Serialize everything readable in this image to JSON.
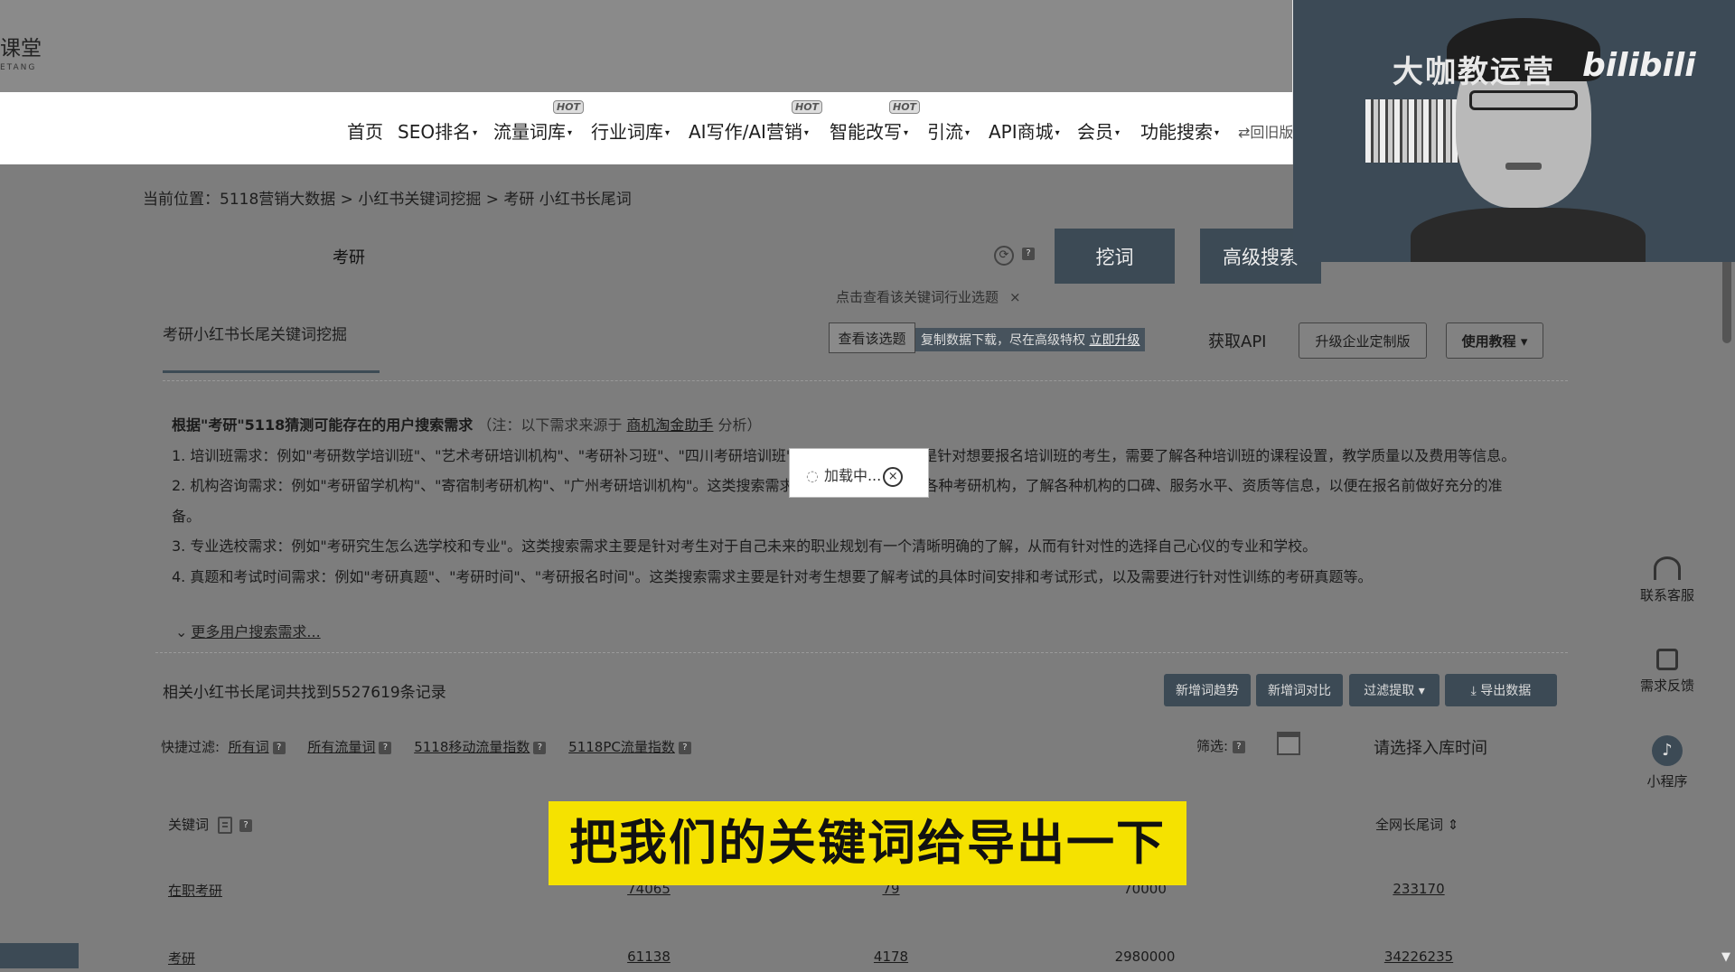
{
  "logo": {
    "main": "课堂",
    "sub": "ETANG"
  },
  "nav": {
    "items": [
      {
        "label": "首页",
        "caret": ""
      },
      {
        "label": "SEO排名",
        "caret": "▾"
      },
      {
        "label": "流量词库",
        "caret": "▾",
        "hot": "HOT"
      },
      {
        "label": "行业词库",
        "caret": "▾"
      },
      {
        "label": "AI写作/AI营销",
        "caret": "▾",
        "hot": "HOT"
      },
      {
        "label": "智能改写",
        "caret": "▾",
        "hot": "HOT"
      },
      {
        "label": "引流",
        "caret": "▾"
      },
      {
        "label": "API商城",
        "caret": "▾"
      },
      {
        "label": "会员",
        "caret": "▾"
      },
      {
        "label": "功能搜索",
        "caret": "▾"
      }
    ],
    "old_version": "⇄回旧版"
  },
  "breadcrumb": "当前位置：5118营销大数据 > 小红书关键词挖掘 > 考研 小红书长尾词",
  "search": {
    "value": "考研",
    "dig_button": "挖词",
    "advanced_button": "高级搜索",
    "hint": "点击查看该关键词行业选题",
    "hint_close": "×",
    "help": "?"
  },
  "tab": {
    "title": "考研小红书长尾关键词挖掘"
  },
  "actions": {
    "view_topic": "查看该选题",
    "promo_text": "复制数据下载，尽在高级特权",
    "promo_link": "立即升级",
    "api": "获取API",
    "enterprise": "升级企业定制版",
    "tutorial": "使用教程 ▾"
  },
  "needs": {
    "lead": "根据\"考研\"5118猜测可能存在的用户搜索需求",
    "note_prefix": "（注：以下需求来源于",
    "note_link": "商机淘金助手",
    "note_suffix": "分析）",
    "items": [
      "1. 培训班需求：例如\"考研数学培训班\"、\"艺术考研培训机构\"、\"考研补习班\"、\"四川考研培训班\"。这类搜索需求主要是针对想要报名培训班的考生，需要了解各种培训班的课程设置，教学质量以及费用等信息。",
      "2. 机构咨询需求：例如\"考研留学机构\"、\"寄宿制考研机构\"、\"广州考研培训机构\"。这类搜索需求主要是针对想要了解各种考研机构，了解各种机构的口碑、服务水平、资质等信息，以便在报名前做好充分的准备。",
      "3. 专业选校需求：例如\"考研究生怎么选学校和专业\"。这类搜索需求主要是针对考生对于自己未来的职业规划有一个清晰明确的了解，从而有针对性的选择自己心仪的专业和学校。",
      "4. 真题和考试时间需求：例如\"考研真题\"、\"考研时间\"、\"考研报名时间\"。这类搜索需求主要是针对考生想要了解考试的具体时间安排和考试形式，以及需要进行针对性训练的考研真题等。"
    ],
    "more": "更多用户搜索需求..."
  },
  "loading": {
    "text": "加载中...",
    "close": "×"
  },
  "results": {
    "summary": "相关小红书长尾词共找到5527619条记录",
    "buttons": {
      "trend": "新增词趋势",
      "compare": "新增词对比",
      "filter": "过滤提取 ▾",
      "export": "⤓ 导出数据"
    },
    "quick_filter_label": "快捷过滤:",
    "quick_filters": [
      "所有词",
      "所有流量词",
      "5118移动流量指数",
      "5118PC流量指数"
    ],
    "screen_label": "筛选:",
    "date_select": "请选择入库时间"
  },
  "table": {
    "headers": {
      "keyword": "关键词",
      "longtail": "全网长尾词 ⇕"
    },
    "rows": [
      {
        "keyword": "在职考研",
        "c1": "74065",
        "c2": "79",
        "c3": "70000",
        "c4": "233170"
      },
      {
        "keyword": "考研",
        "c1": "61138",
        "c2": "4178",
        "c3": "2980000",
        "c4": "34226235"
      }
    ]
  },
  "webcam": {
    "title": "大咖教运营",
    "logo": "bilibili"
  },
  "side": {
    "service": "联系客服",
    "feedback": "需求反馈",
    "mini": "小程序"
  },
  "caption": "把我们的关键词给导出一下"
}
